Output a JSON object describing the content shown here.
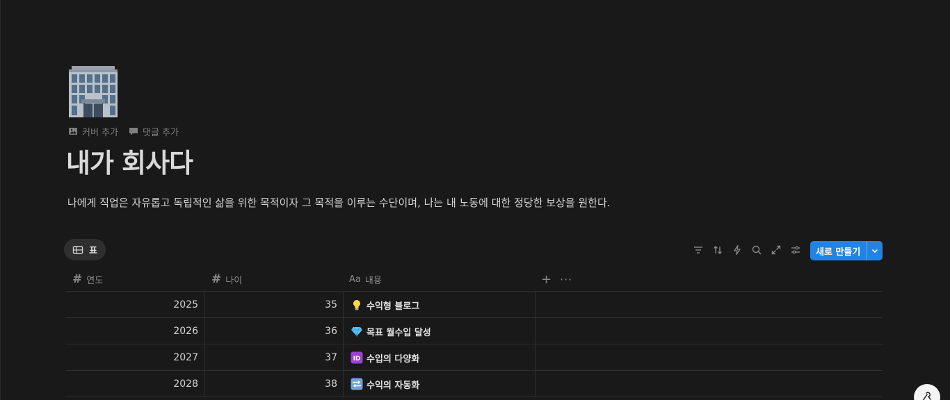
{
  "page": {
    "icon": "office-building-icon",
    "actions": [
      {
        "label": "커버 추가",
        "icon": "image-icon"
      },
      {
        "label": "댓글 추가",
        "icon": "comment-icon"
      }
    ],
    "title": "내가 회사다",
    "description": "나에게 직업은 자유롭고 독립적인 삶을 위한 목적이자 그 목적을 이루는 수단이며, 나는 내 노동에 대한 정당한 보상을 원한다."
  },
  "view": {
    "tab_label": "표",
    "tab_icon": "table-icon"
  },
  "toolbar": {
    "icons": [
      "filter-icon",
      "sort-icon",
      "automation-bolt-icon",
      "search-icon",
      "expand-icon",
      "settings-sliders-icon"
    ],
    "new_button_label": "새로 만들기"
  },
  "table": {
    "columns": [
      {
        "label": "연도",
        "type": "number"
      },
      {
        "label": "나이",
        "type": "number"
      },
      {
        "label": "내용",
        "type": "title"
      }
    ],
    "rows": [
      {
        "year": "2025",
        "age": "35",
        "emoji": "lightbulb",
        "title": "수익형 블로그"
      },
      {
        "year": "2026",
        "age": "36",
        "emoji": "gem",
        "title": "목표 월수입 달성"
      },
      {
        "year": "2027",
        "age": "37",
        "emoji": "id-badge",
        "title": "수입의 다양화"
      },
      {
        "year": "2028",
        "age": "38",
        "emoji": "repeat",
        "title": "수익의 자동화"
      }
    ]
  },
  "colors": {
    "background": "#191919",
    "accent": "#2383e2",
    "text": "#d4d4d4",
    "muted": "#7f7f7f"
  }
}
